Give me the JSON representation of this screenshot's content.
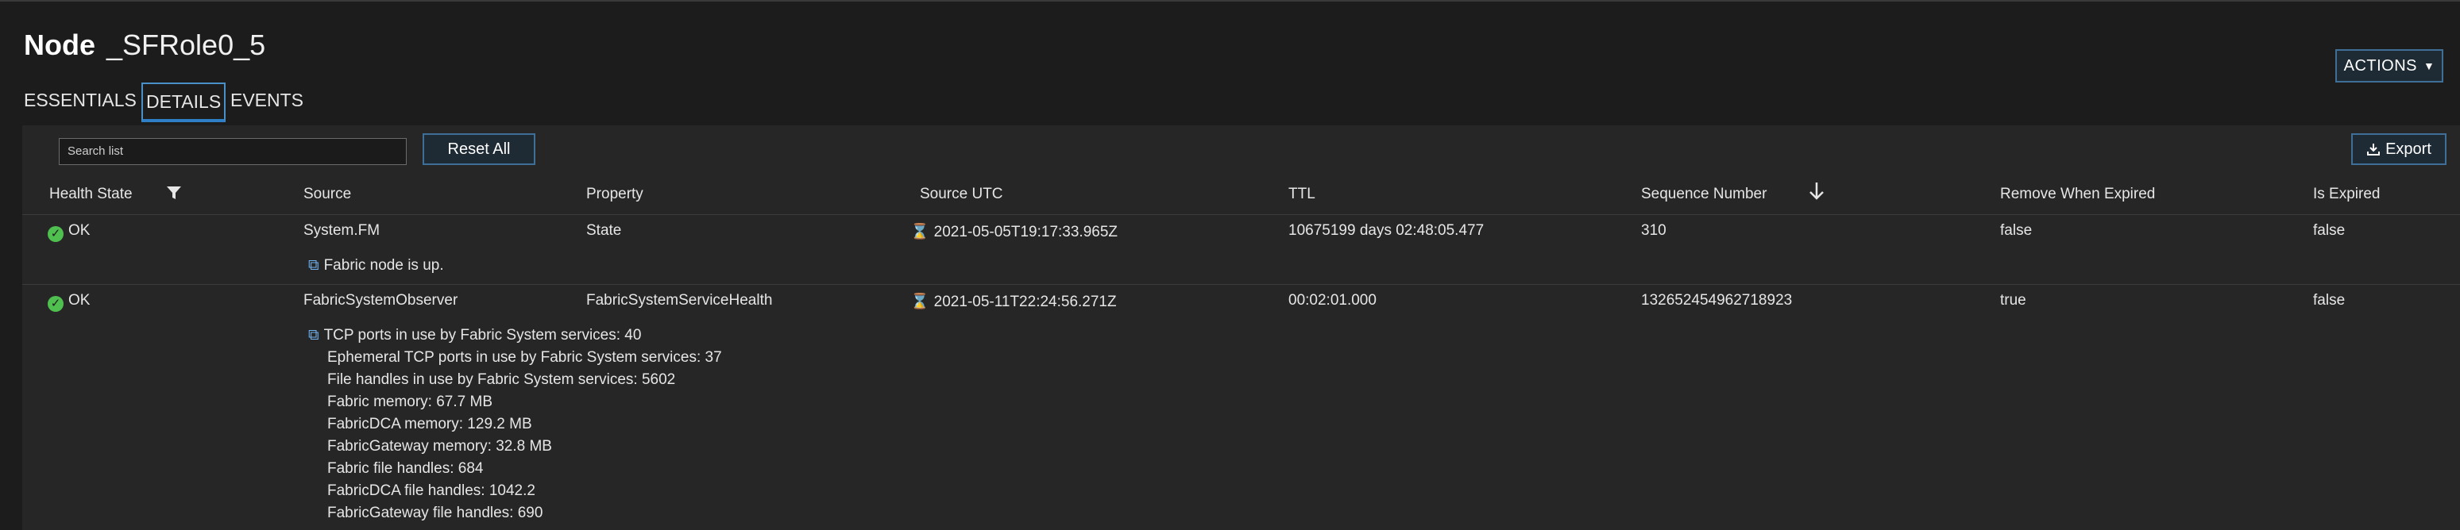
{
  "page": {
    "title_kind": "Node",
    "title_name": "_SFRole0_5",
    "actions_label": "ACTIONS"
  },
  "tabs": [
    {
      "label": "ESSENTIALS",
      "active": false
    },
    {
      "label": "DETAILS",
      "active": true
    },
    {
      "label": "EVENTS",
      "active": false
    }
  ],
  "toolbar": {
    "search_placeholder": "Search list",
    "reset_label": "Reset All",
    "export_label": "Export"
  },
  "columns": [
    "Health State",
    "Source",
    "Property",
    "Source UTC",
    "TTL",
    "Sequence Number",
    "Remove When Expired",
    "Is Expired"
  ],
  "rows": [
    {
      "health": "OK",
      "source": "System.FM",
      "property": "State",
      "source_utc": "2021-05-05T19:17:33.965Z",
      "ttl": "10675199 days 02:48:05.477",
      "sequence": "310",
      "remove_when_expired": "false",
      "is_expired": "false",
      "description": [
        "Fabric node is up."
      ]
    },
    {
      "health": "OK",
      "source": "FabricSystemObserver",
      "property": "FabricSystemServiceHealth",
      "source_utc": "2021-05-11T22:24:56.271Z",
      "ttl": "00:02:01.000",
      "sequence": "132652454962718923",
      "remove_when_expired": "true",
      "is_expired": "false",
      "description": [
        "TCP ports in use by Fabric System services: 40",
        "Ephemeral TCP ports in use by Fabric System services: 37",
        "File handles in use by Fabric System services: 5602",
        "Fabric memory: 67.7 MB",
        "FabricDCA memory: 129.2 MB",
        "FabricGateway memory: 32.8 MB",
        "Fabric file handles: 684",
        "FabricDCA file handles: 1042.2",
        "FabricGateway file handles: 690"
      ]
    }
  ],
  "icons": {
    "filter": "filter-icon",
    "sort": "arrow-down-icon",
    "ok": "check-circle-icon",
    "time": "hourglass-icon",
    "copy": "copy-icon",
    "export": "download-icon"
  },
  "colors": {
    "background": "#1c1c1c",
    "panel": "#262626",
    "accent": "#2f7fc6",
    "ok": "#4fbf4f"
  }
}
